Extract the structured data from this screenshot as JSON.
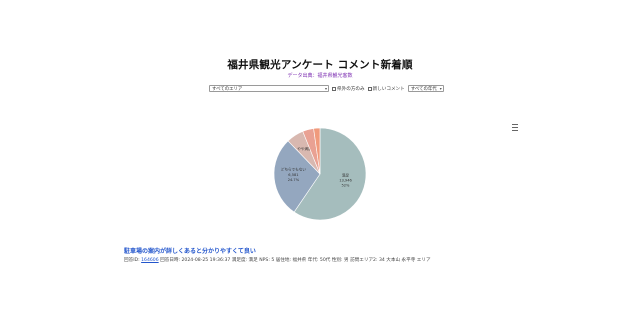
{
  "page": {
    "title": "福井県観光アンケート コメント新着順",
    "source_prefix": "データ出典：",
    "source_link": "福井県観光客数"
  },
  "filters": {
    "area_select": "すべてのエリア",
    "checkbox_1": "県外の方のみ",
    "checkbox_2": "新しいコメント",
    "age_select": "すべての年代"
  },
  "chart_data": {
    "type": "pie",
    "slices": [
      {
        "label": "満足",
        "count": "13,946",
        "percent": 52,
        "percent_label": "52%",
        "color": "#a5bdbd"
      },
      {
        "label": "どちらでもない",
        "count": "6,581",
        "percent": 24.7,
        "percent_label": "24.7%",
        "color": "#94a7bf"
      },
      {
        "label": "やや満足",
        "count": "",
        "percent": 0,
        "percent_label": "",
        "color": "#d8b8b0"
      },
      {
        "label": "",
        "count": "",
        "percent": 0,
        "percent_label": "",
        "color": "#e9a193"
      },
      {
        "label": "",
        "count": "",
        "percent": 0,
        "percent_label": "",
        "color": "#f09a7c"
      }
    ]
  },
  "comment": {
    "title": "駐車場の案内が詳しくあると分かりやすくて良い",
    "id_label": "回答ID:",
    "id_value": "164606",
    "rest": "回答日時: 2024-08-25 19:36:37 満足度: 満足 NPS: 5 居住地: 福井県 年代: 50代 性別: 男 訪問エリア2: 34 大本山 永平寺 エリア"
  },
  "colors": {
    "accent": "#2255cc",
    "source": "#7a2ab0"
  },
  "icons": {
    "menu": "hamburger-menu-icon"
  }
}
